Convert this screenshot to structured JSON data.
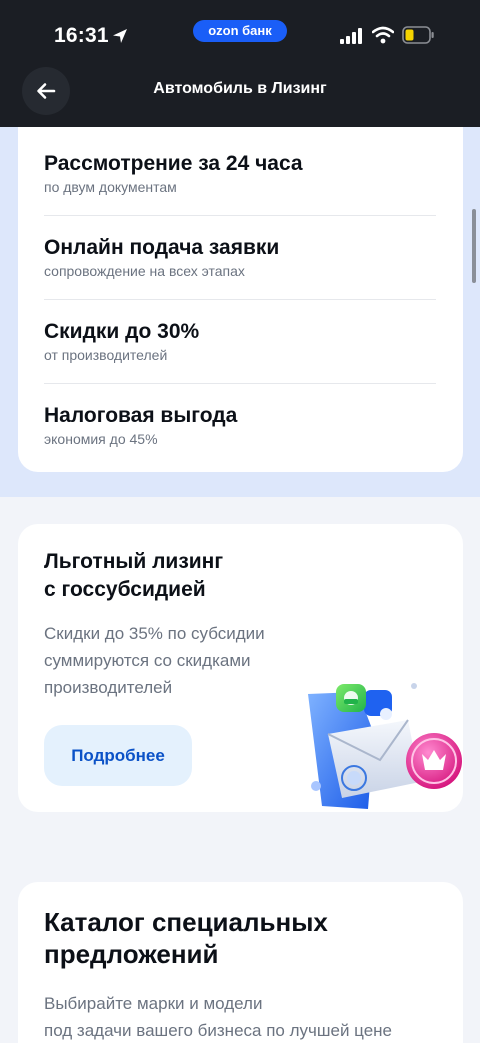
{
  "status_bar": {
    "time": "16:31",
    "bank_badge": "ozon банк"
  },
  "header": {
    "title": "Автомобиль в Лизинг"
  },
  "features": [
    {
      "title": "Рассмотрение за 24 часа",
      "subtitle": "по двум документам"
    },
    {
      "title": "Онлайн подача заявки",
      "subtitle": "сопровождение на всех этапах"
    },
    {
      "title": "Скидки до 30%",
      "subtitle": "от производителей"
    },
    {
      "title": "Налоговая выгода",
      "subtitle": "экономия до 45%"
    }
  ],
  "subsidy": {
    "title_line1": "Льготный лизинг",
    "title_line2": "с госсубсидией",
    "desc_line1": "Скидки до 35% по субсидии",
    "desc_line2": "суммируются со скидками",
    "desc_line3": "производителей",
    "button_label": "Подробнее"
  },
  "catalog": {
    "title_line1": "Каталог специальных",
    "title_line2": "предложений",
    "desc_line1": "Выбирайте марки и модели",
    "desc_line2": "под задачи вашего бизнеса по лучшей цене"
  },
  "colors": {
    "header_bg": "#1b1e24",
    "brand_blue": "#1a5ef7",
    "button_text": "#0b52c7",
    "band_bg": "#dde7fb"
  },
  "icons": [
    "location-arrow-icon",
    "signal-icon",
    "wifi-icon",
    "battery-icon",
    "back-arrow-icon",
    "envelope-illustration"
  ]
}
